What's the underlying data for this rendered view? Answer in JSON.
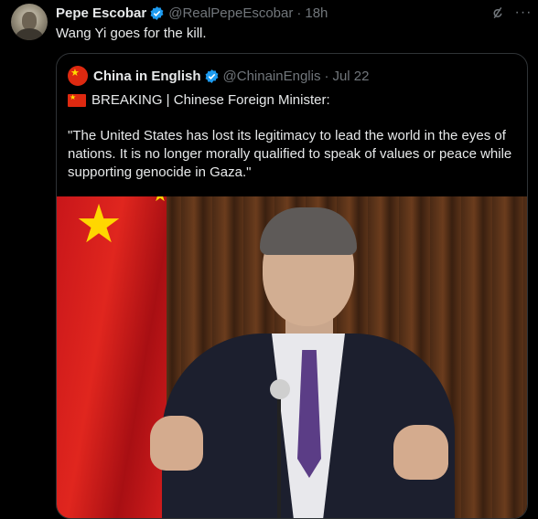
{
  "tweet": {
    "author_name": "Pepe Escobar",
    "handle": "@RealPepeEscobar",
    "separator": "·",
    "time": "18h",
    "text": "Wang Yi goes for the kill."
  },
  "quoted": {
    "author_name": "China in English",
    "handle": "@ChinainEnglis",
    "separator": "·",
    "time": "Jul 22",
    "line1": "BREAKING | Chinese Foreign Minister:",
    "quote": "\"The United States has lost its legitimacy to lead the world in the eyes of nations. It is no longer morally qualified to speak of values or peace while supporting genocide in Gaza.\""
  },
  "icons": {
    "verified": "verified-badge-icon",
    "grok": "grok-icon",
    "more": "more-options-icon"
  },
  "colors": {
    "background": "#000000",
    "text": "#e7e9ea",
    "muted": "#71767b",
    "verified": "#1d9bf0",
    "border": "#2f3336"
  }
}
